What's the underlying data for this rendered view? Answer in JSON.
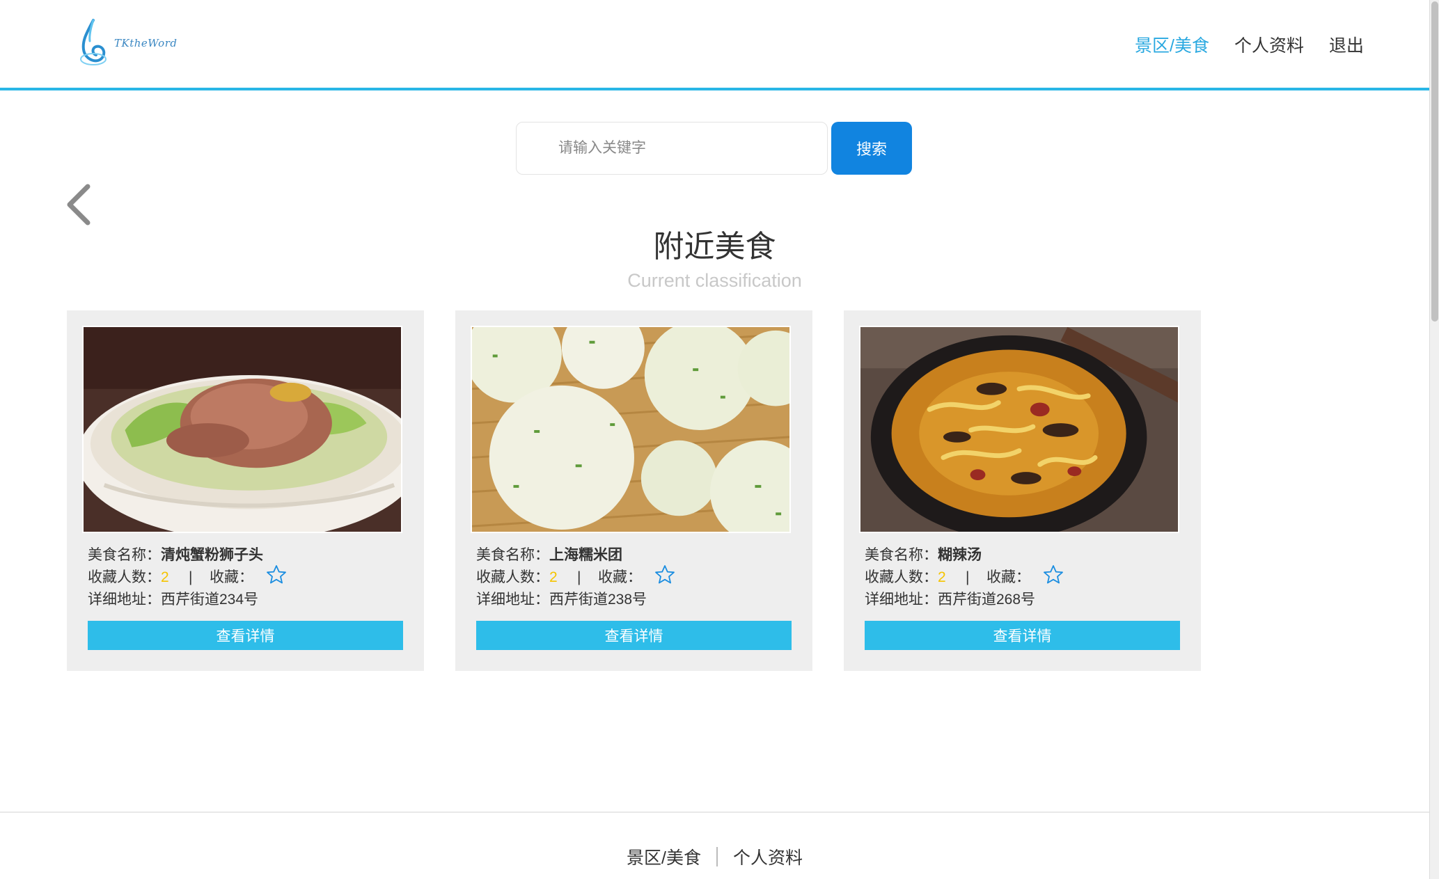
{
  "header": {
    "logo_text": "TKtheWord",
    "nav": [
      {
        "label": "景区/美食",
        "active": true
      },
      {
        "label": "个人资料",
        "active": false
      },
      {
        "label": "退出",
        "active": false
      }
    ]
  },
  "search": {
    "placeholder": "请输入关键字",
    "button_label": "搜索"
  },
  "section": {
    "title": "附近美食",
    "subtitle": "Current classification"
  },
  "cards": [
    {
      "name_label": "美食名称：",
      "name": "清炖蟹粉狮子头",
      "fav_count_label": "收藏人数：",
      "fav_count": "2",
      "separator": "|",
      "fav_label": "收藏：",
      "address_label": "详细地址：",
      "address": "西芹街道234号",
      "button_label": "查看详情",
      "icon": "star-outline-icon"
    },
    {
      "name_label": "美食名称：",
      "name": "上海糯米团",
      "fav_count_label": "收藏人数：",
      "fav_count": "2",
      "separator": "|",
      "fav_label": "收藏：",
      "address_label": "详细地址：",
      "address": "西芹街道238号",
      "button_label": "查看详情",
      "icon": "star-outline-icon"
    },
    {
      "name_label": "美食名称：",
      "name": "糊辣汤",
      "fav_count_label": "收藏人数：",
      "fav_count": "2",
      "separator": "|",
      "fav_label": "收藏：",
      "address_label": "详细地址：",
      "address": "西芹街道268号",
      "button_label": "查看详情",
      "icon": "star-outline-icon"
    }
  ],
  "footer": {
    "links": [
      "景区/美食",
      "个人资料"
    ]
  },
  "colors": {
    "accent": "#29b6e6",
    "search_button": "#1184e0",
    "detail_button": "#2ebde9",
    "count": "#f5c400",
    "card_bg": "#eeeeee"
  }
}
